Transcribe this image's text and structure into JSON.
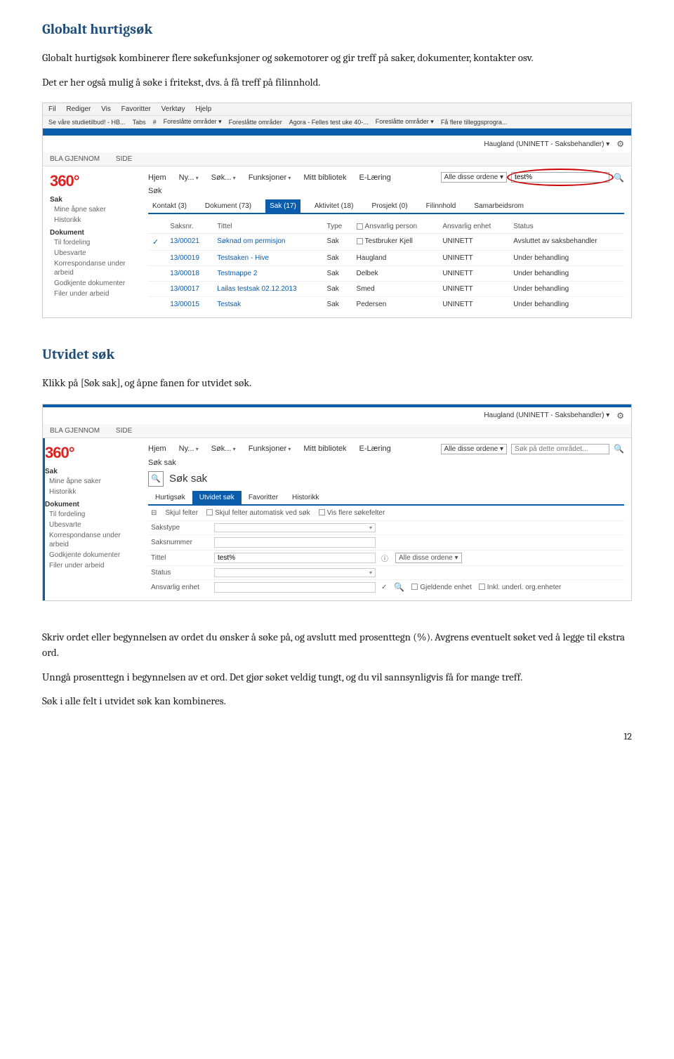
{
  "doc": {
    "h1": "Globalt hurtigsøk",
    "p1": "Globalt hurtigsøk kombinerer flere søkefunksjoner og søkemotorer og gir treff på saker, dokumenter, kontakter osv.",
    "p2": "Det er her også mulig å søke i fritekst, dvs. å få treff på filinnhold.",
    "h2": "Utvidet søk",
    "p3": "Klikk på [Søk sak], og åpne fanen for utvidet søk.",
    "p4": "Skriv ordet eller begynnelsen av ordet du ønsker å søke på, og avslutt med prosenttegn (%). Avgrens eventuelt søket ved å legge til ekstra ord.",
    "p5": "Unngå prosenttegn i begynnelsen av et ord. Det gjør søket veldig tungt, og du vil sannsynligvis få for mange treff.",
    "p6": "Søk i alle felt i utvidet søk kan kombineres.",
    "page_num": "12"
  },
  "shot1": {
    "menubar": [
      "Fil",
      "Rediger",
      "Vis",
      "Favoritter",
      "Verktøy",
      "Hjelp"
    ],
    "favbar": [
      "Se våre studietilbud! - HB...",
      "Tabs",
      "#",
      "Foreslåtte områder ▾",
      "Foreslåtte områder",
      "Agora - Felles test uke 40-...",
      "Foreslåtte områder ▾",
      "Få flere tilleggsprogra..."
    ],
    "user": "Haugland (UNINETT - Saksbehandler) ▾",
    "ribbon": [
      "BLA GJENNOM",
      "SIDE"
    ],
    "logo": "360°",
    "sidebar": {
      "cat1": "Sak",
      "items1": [
        "Mine åpne saker",
        "Historikk"
      ],
      "cat2": "Dokument",
      "items2": [
        "Til fordeling",
        "Ubesvarte",
        "Korrespondanse under arbeid",
        "Godkjente dokumenter",
        "Filer under arbeid"
      ]
    },
    "topnav": [
      "Hjem",
      "Ny...",
      "Søk...",
      "Funksjoner",
      "Mitt bibliotek",
      "E-Læring"
    ],
    "search_mode": "Alle disse ordene",
    "search_value": "test%",
    "subnav": "Søk",
    "tabs": [
      {
        "label": "Kontakt (3)",
        "active": false
      },
      {
        "label": "Dokument (73)",
        "active": false
      },
      {
        "label": "Sak (17)",
        "active": true
      },
      {
        "label": "Aktivitet (18)",
        "active": false
      },
      {
        "label": "Prosjekt (0)",
        "active": false
      },
      {
        "label": "Filinnhold",
        "active": false
      },
      {
        "label": "Samarbeidsrom",
        "active": false
      }
    ],
    "columns": [
      "Saksnr.",
      "Tittel",
      "Type",
      "Ansvarlig person",
      "Ansvarlig enhet",
      "Status"
    ],
    "col_ansvarlig_prefix": "☐ ",
    "rows": [
      {
        "saksnr": "13/00021",
        "tittel": "Søknad om permisjon",
        "type": "Sak",
        "ansvarlig": "Testbruker Kjell",
        "ansvarlig_prefix": "☐ ",
        "enhet": "UNINETT",
        "status": "Avsluttet av saksbehandler",
        "check": true
      },
      {
        "saksnr": "13/00019",
        "tittel": "Testsaken - Hive",
        "type": "Sak",
        "ansvarlig": "Haugland",
        "enhet": "UNINETT",
        "status": "Under behandling"
      },
      {
        "saksnr": "13/00018",
        "tittel": "Testmappe 2",
        "type": "Sak",
        "ansvarlig": "Delbek",
        "enhet": "UNINETT",
        "status": "Under behandling"
      },
      {
        "saksnr": "13/00017",
        "tittel": "Lailas testsak 02.12.2013",
        "type": "Sak",
        "ansvarlig": "Smed",
        "enhet": "UNINETT",
        "status": "Under behandling"
      },
      {
        "saksnr": "13/00015",
        "tittel": "Testsak",
        "type": "Sak",
        "ansvarlig": "Pedersen",
        "enhet": "UNINETT",
        "status": "Under behandling"
      }
    ]
  },
  "shot2": {
    "user": "Haugland (UNINETT - Saksbehandler) ▾",
    "ribbon": [
      "BLA GJENNOM",
      "SIDE"
    ],
    "logo": "360°",
    "sidebar": {
      "cat1": "Sak",
      "items1": [
        "Mine åpne saker",
        "Historikk"
      ],
      "cat2": "Dokument",
      "items2": [
        "Til fordeling",
        "Ubesvarte",
        "Korrespondanse under arbeid",
        "Godkjente dokumenter",
        "Filer under arbeid"
      ]
    },
    "topnav": [
      "Hjem",
      "Ny...",
      "Søk...",
      "Funksjoner",
      "Mitt bibliotek",
      "E-Læring"
    ],
    "search_mode": "Alle disse ordene",
    "search_placeholder": "Søk på dette området...",
    "subnav": "Søk sak",
    "panel_title": "Søk sak",
    "tabs": [
      {
        "label": "Hurtigsøk",
        "active": false
      },
      {
        "label": "Utvidet søk",
        "active": true
      },
      {
        "label": "Favoritter",
        "active": false
      },
      {
        "label": "Historikk",
        "active": false
      }
    ],
    "filter": {
      "skjul_felter": "Skjul felter",
      "auto": "Skjul felter automatisk ved søk",
      "vis": "Vis flere søkefelter"
    },
    "form": {
      "sakstype": {
        "label": "Sakstype",
        "value": ""
      },
      "saksnummer": {
        "label": "Saksnummer",
        "value": ""
      },
      "tittel": {
        "label": "Tittel",
        "value": "test%",
        "mode": "Alle disse ordene"
      },
      "status": {
        "label": "Status",
        "value": ""
      },
      "enhet": {
        "label": "Ansvarlig enhet",
        "value": "",
        "gjeldende": "Gjeldende enhet",
        "inkl": "Inkl. underl. org.enheter"
      }
    }
  }
}
